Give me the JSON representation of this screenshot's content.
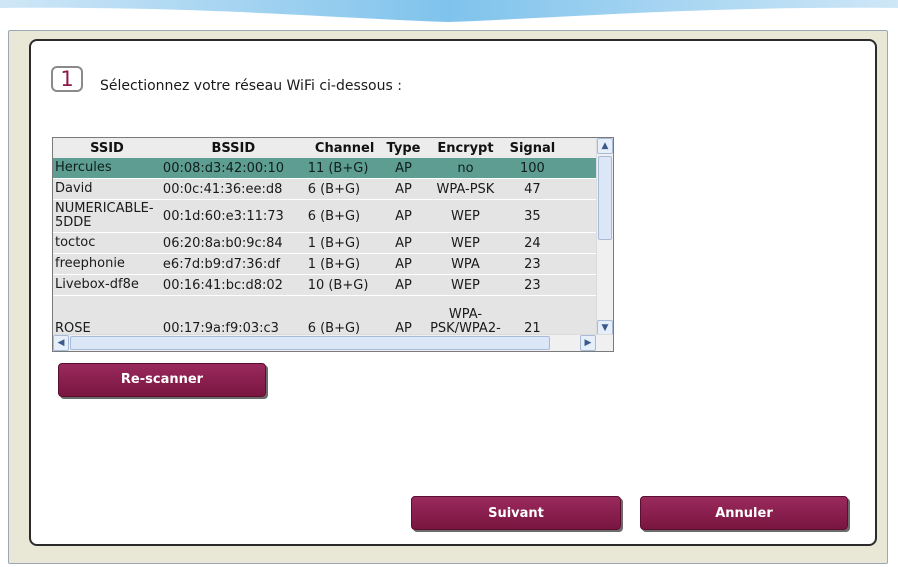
{
  "step": {
    "number": "1",
    "title": "Sélectionnez votre réseau WiFi ci-dessous :"
  },
  "networks": {
    "headers": {
      "ssid": "SSID",
      "bssid": "BSSID",
      "channel": "Channel",
      "type": "Type",
      "encrypt": "Encrypt",
      "signal": "Signal"
    },
    "rows": [
      {
        "ssid": "Hercules",
        "bssid": "00:08:d3:42:00:10",
        "channel": "11 (B+G)",
        "type": "AP",
        "encrypt": "no",
        "signal": "100",
        "selected": true
      },
      {
        "ssid": "David",
        "bssid": "00:0c:41:36:ee:d8",
        "channel": "6 (B+G)",
        "type": "AP",
        "encrypt": "WPA-PSK",
        "signal": "47"
      },
      {
        "ssid": "NUMERICABLE-5DDE",
        "bssid": "00:1d:60:e3:11:73",
        "channel": "6 (B+G)",
        "type": "AP",
        "encrypt": "WEP",
        "signal": "35"
      },
      {
        "ssid": "toctoc",
        "bssid": "06:20:8a:b0:9c:84",
        "channel": "1 (B+G)",
        "type": "AP",
        "encrypt": "WEP",
        "signal": "24"
      },
      {
        "ssid": "freephonie",
        "bssid": "e6:7d:b9:d7:36:df",
        "channel": "1 (B+G)",
        "type": "AP",
        "encrypt": "WPA",
        "signal": "23"
      },
      {
        "ssid": "Livebox-df8e",
        "bssid": "00:16:41:bc:d8:02",
        "channel": "10 (B+G)",
        "type": "AP",
        "encrypt": "WEP",
        "signal": "23"
      },
      {
        "ssid": "ROSE",
        "bssid": "00:17:9a:f9:03:c3",
        "channel": "6 (B+G)",
        "type": "AP",
        "encrypt": "WPA-PSK/WPA2-",
        "signal": "21"
      }
    ]
  },
  "buttons": {
    "rescan": "Re-scanner",
    "next": "Suivant",
    "cancel": "Annuler"
  },
  "colors": {
    "accent": "#8b1a4b",
    "selected_row": "#5e9d92",
    "frame_bg": "#e9e8d6"
  }
}
